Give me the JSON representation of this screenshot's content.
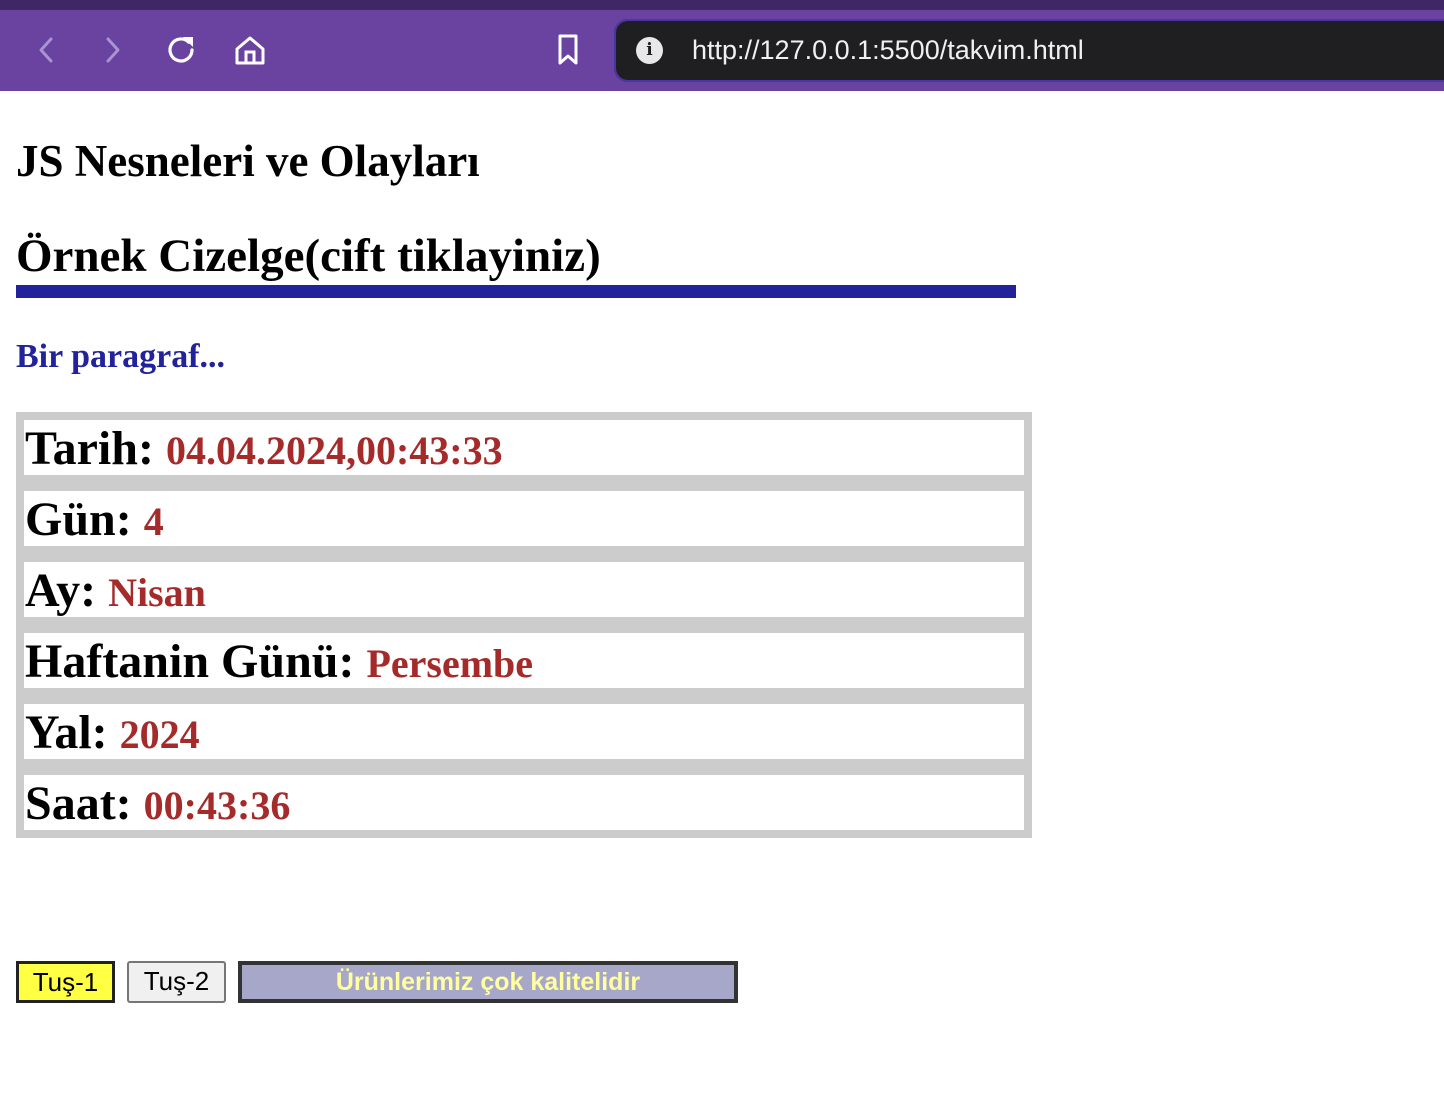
{
  "browser": {
    "url": "http://127.0.0.1:5500/takvim.html",
    "info_glyph": "i",
    "icons": [
      "back-icon",
      "forward-icon",
      "reload-icon",
      "home-icon",
      "bookmark-icon",
      "info-icon"
    ],
    "colors": {
      "toolbar": "#6a42a0",
      "url_bar": "#1f1f22"
    }
  },
  "page": {
    "title": "JS Nesneleri ve Olayları",
    "subtitle": "Örnek Cizelge(cift tiklayiniz)",
    "paragraph": "Bir paragraf...",
    "colors": {
      "rule": "#22229a",
      "paragraph": "#22229a",
      "value": "#a52a2a",
      "table_background": "#cccccc"
    }
  },
  "calendar": {
    "rows": [
      {
        "label": "Tarih:",
        "value": "04.04.2024,00:43:33"
      },
      {
        "label": "Gün:",
        "value": "4"
      },
      {
        "label": "Ay:",
        "value": "Nisan"
      },
      {
        "label": "Haftanin Günü:",
        "value": "Persembe"
      },
      {
        "label": "Yal:",
        "value": "2024"
      },
      {
        "label": "Saat:",
        "value": "00:43:36"
      }
    ]
  },
  "buttons": {
    "button1": {
      "label": "Tuş-1",
      "color": "#ffff44"
    },
    "button2": {
      "label": "Tuş-2",
      "color": "#f0f0f0"
    },
    "banner": {
      "label": "Ürünlerimiz çok kalitelidir",
      "color": "#a7a7c9",
      "text_color": "#ffffa0"
    }
  }
}
